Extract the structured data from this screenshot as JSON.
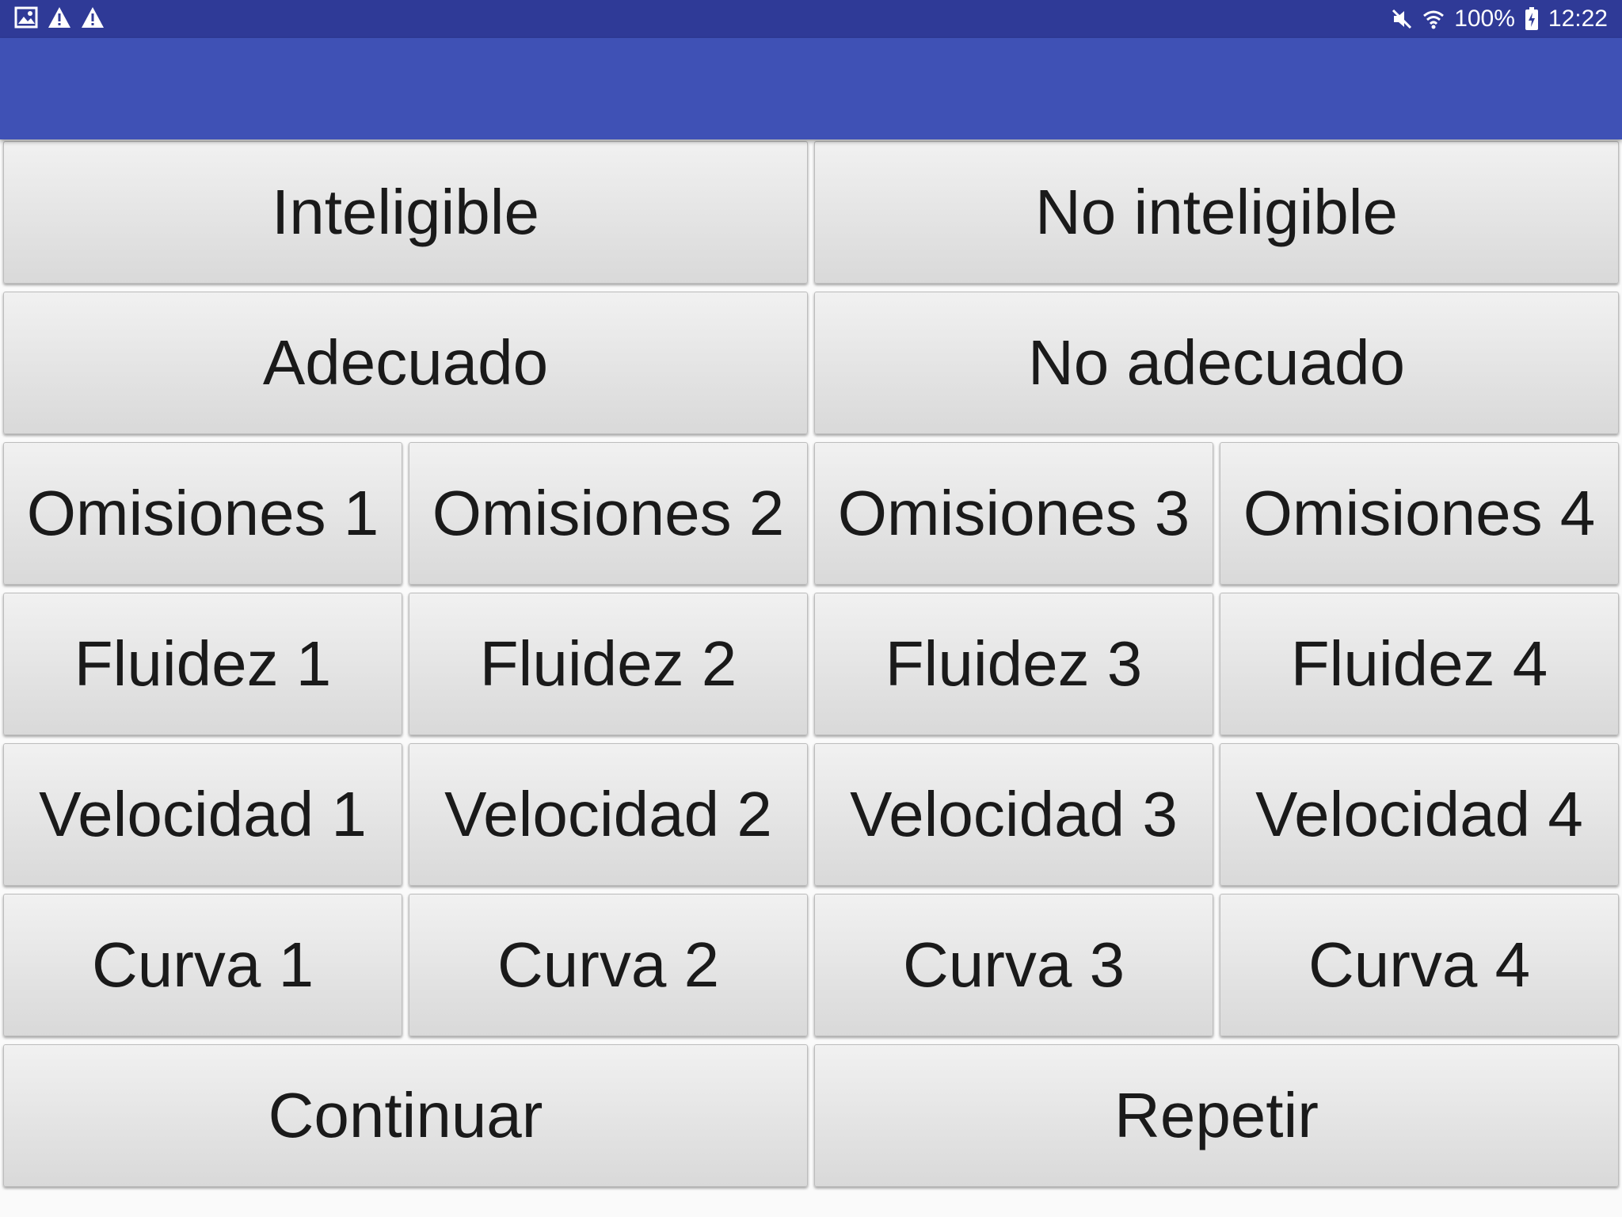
{
  "status_bar": {
    "left_icons": [
      "image-icon",
      "warning-icon",
      "warning-icon"
    ],
    "right_icons": [
      "mute-icon",
      "wifi-icon",
      "battery-charging-icon"
    ],
    "battery": "100%",
    "time": "12:22"
  },
  "colors": {
    "status_bar": "#2f3a97",
    "app_bar": "#3f51b5",
    "button_top": "#f1f1f1",
    "button_bottom": "#d9d9d9"
  },
  "buttons": {
    "inteligible": "Inteligible",
    "no_inteligible": "No inteligible",
    "adecuado": "Adecuado",
    "no_adecuado": "No adecuado",
    "omisiones": [
      "Omisiones 1",
      "Omisiones 2",
      "Omisiones 3",
      "Omisiones 4"
    ],
    "fluidez": [
      "Fluidez 1",
      "Fluidez 2",
      "Fluidez 3",
      "Fluidez 4"
    ],
    "velocidad": [
      "Velocidad 1",
      "Velocidad 2",
      "Velocidad 3",
      "Velocidad 4"
    ],
    "curva": [
      "Curva 1",
      "Curva 2",
      "Curva 3",
      "Curva 4"
    ],
    "continuar": "Continuar",
    "repetir": "Repetir"
  }
}
